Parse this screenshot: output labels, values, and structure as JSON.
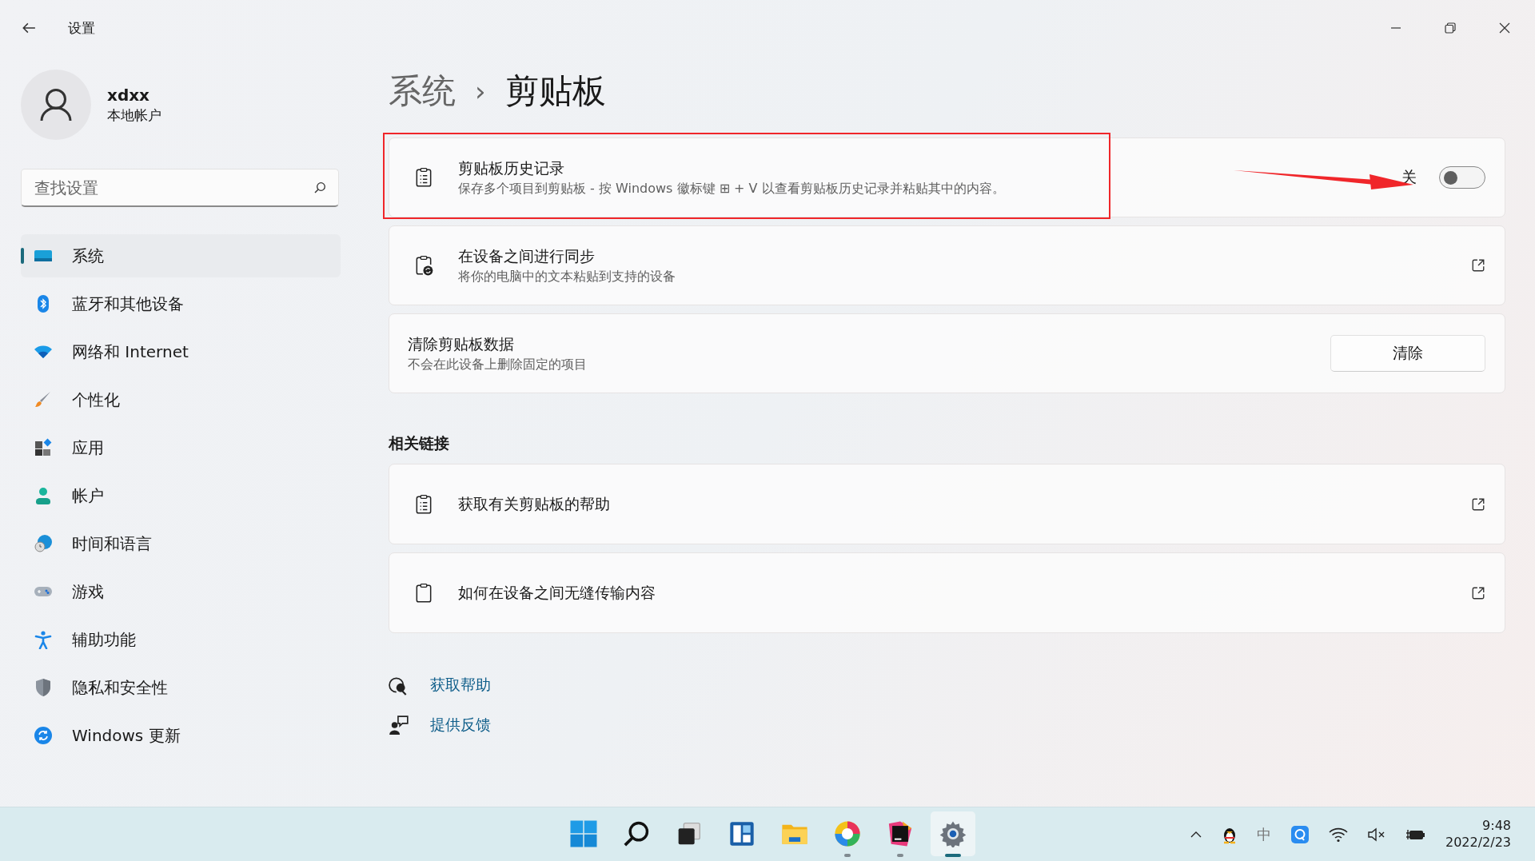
{
  "window": {
    "title": "设置"
  },
  "user": {
    "name": "xdxx",
    "account_type": "本地帐户"
  },
  "search": {
    "placeholder": "查找设置"
  },
  "nav": [
    {
      "label": "系统",
      "selected": true
    },
    {
      "label": "蓝牙和其他设备",
      "selected": false
    },
    {
      "label": "网络和 Internet",
      "selected": false
    },
    {
      "label": "个性化",
      "selected": false
    },
    {
      "label": "应用",
      "selected": false
    },
    {
      "label": "帐户",
      "selected": false
    },
    {
      "label": "时间和语言",
      "selected": false
    },
    {
      "label": "游戏",
      "selected": false
    },
    {
      "label": "辅助功能",
      "selected": false
    },
    {
      "label": "隐私和安全性",
      "selected": false
    },
    {
      "label": "Windows 更新",
      "selected": false
    }
  ],
  "breadcrumb": {
    "parent": "系统",
    "separator": "›",
    "current": "剪贴板"
  },
  "settings": [
    {
      "kind": "toggle",
      "title": "剪贴板历史记录",
      "description": "保存多个项目到剪贴板 - 按 Windows 徽标键 ⊞ + V 以查看剪贴板历史记录并粘贴其中的内容。",
      "state_label": "关",
      "on": false
    },
    {
      "kind": "link",
      "title": "在设备之间进行同步",
      "description": "将你的电脑中的文本粘贴到支持的设备"
    },
    {
      "kind": "button",
      "title": "清除剪贴板数据",
      "description": "不会在此设备上删除固定的项目",
      "button": "清除"
    }
  ],
  "related": {
    "heading": "相关链接",
    "links": [
      {
        "title": "获取有关剪贴板的帮助"
      },
      {
        "title": "如何在设备之间无缝传输内容"
      }
    ]
  },
  "help_links": [
    {
      "label": "获取帮助"
    },
    {
      "label": "提供反馈"
    }
  ],
  "taskbar": {
    "apps": [
      {
        "running": false,
        "selected": false
      },
      {
        "running": false,
        "selected": false
      },
      {
        "running": false,
        "selected": false
      },
      {
        "running": false,
        "selected": false
      },
      {
        "running": false,
        "selected": false
      },
      {
        "running": true,
        "selected": false
      },
      {
        "running": true,
        "selected": false
      },
      {
        "running": true,
        "selected": true
      }
    ],
    "ime": "中",
    "time": "9:48",
    "date": "2022/2/23"
  }
}
